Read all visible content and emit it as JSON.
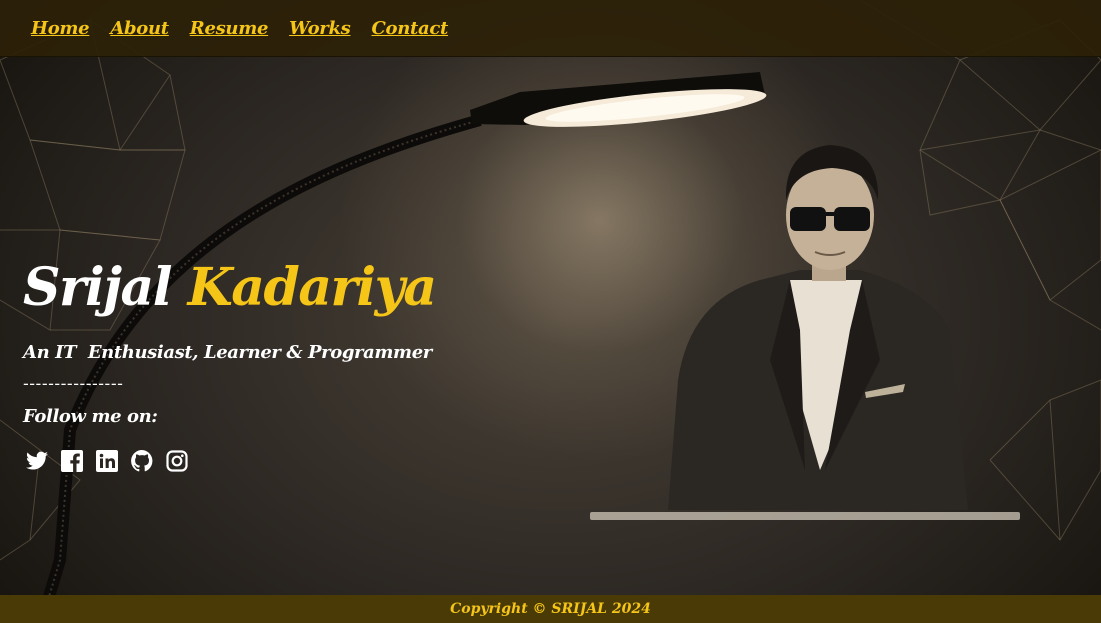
{
  "nav": {
    "items": [
      {
        "label": "Home"
      },
      {
        "label": "About"
      },
      {
        "label": "Resume"
      },
      {
        "label": "Works"
      },
      {
        "label": "Contact"
      }
    ]
  },
  "hero": {
    "first_name": "Srijal",
    "last_name": "Kadariya",
    "tagline": "An IT  Enthusiast, Learner & Programmer",
    "divider": "----------------",
    "follow_label": "Follow me on:",
    "socials": [
      {
        "icon": "twitter-icon"
      },
      {
        "icon": "facebook-icon"
      },
      {
        "icon": "linkedin-icon"
      },
      {
        "icon": "github-icon"
      },
      {
        "icon": "instagram-icon"
      }
    ]
  },
  "footer": {
    "copyright": "Copyright © SRIJAL 2024"
  },
  "colors": {
    "accent": "#f5c518",
    "nav_bg": "#2d2108",
    "footer_bg": "#4a3b06",
    "text": "#ffffff"
  }
}
